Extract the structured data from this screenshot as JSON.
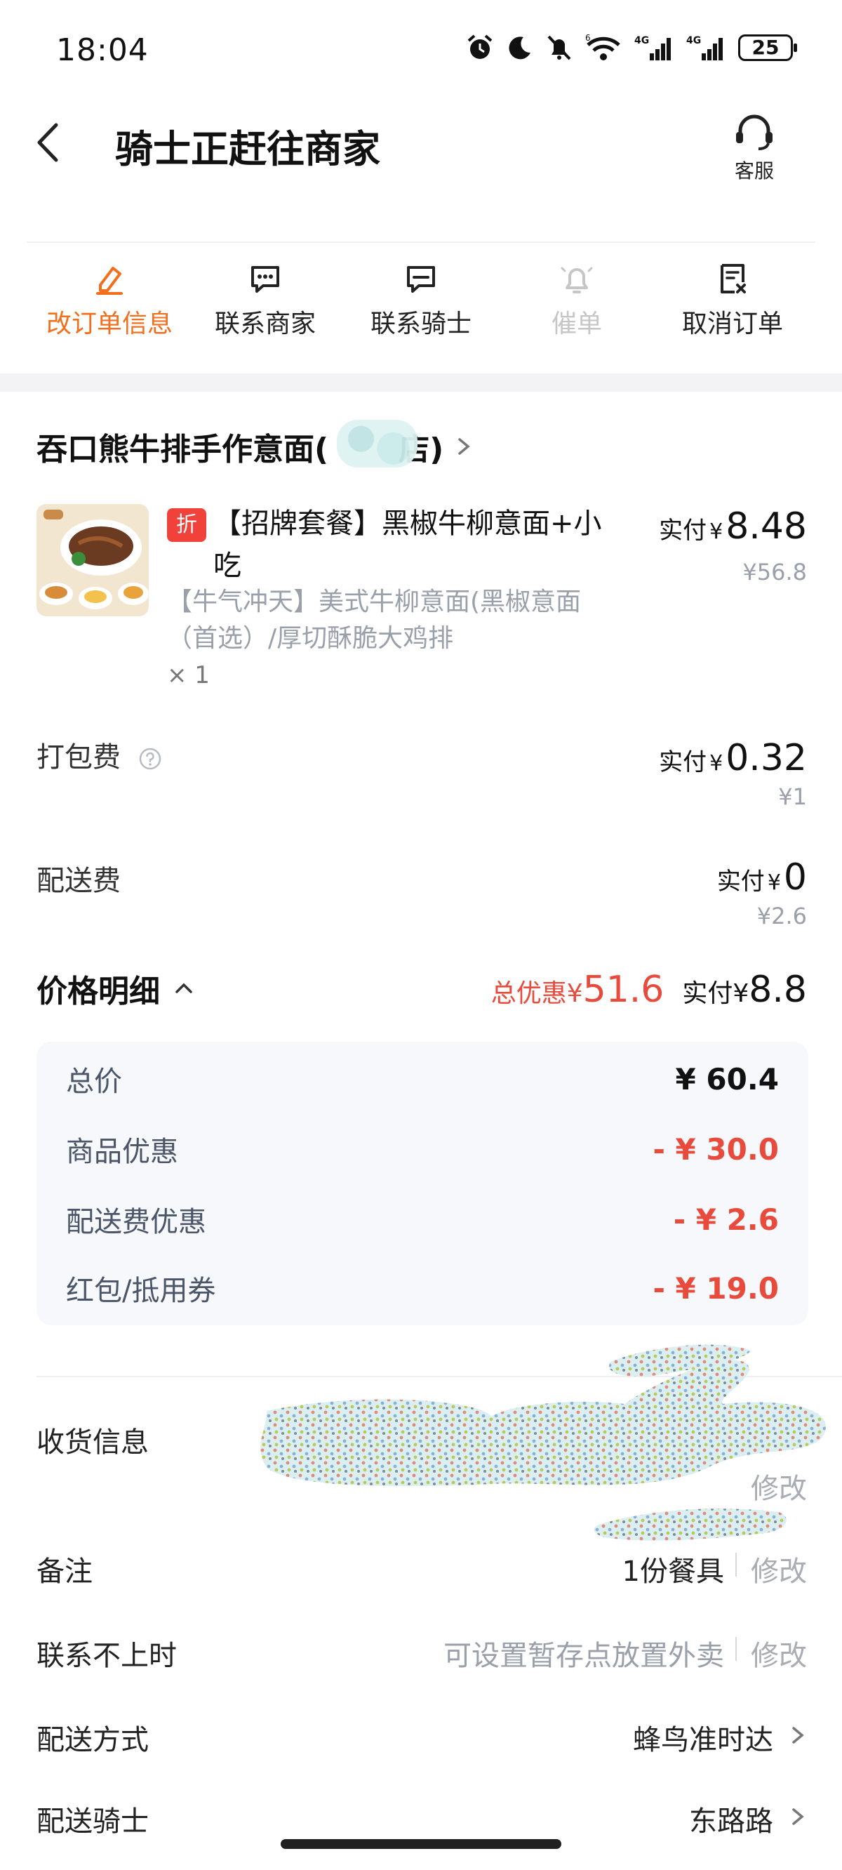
{
  "status_bar": {
    "time": "18:04",
    "battery": "25"
  },
  "header": {
    "title": "骑士正赶往商家",
    "service_label": "客服"
  },
  "actions": [
    {
      "label": "改订单信息",
      "state": "active",
      "icon": "edit-icon"
    },
    {
      "label": "联系商家",
      "state": "normal",
      "icon": "chat-icon"
    },
    {
      "label": "联系骑士",
      "state": "normal",
      "icon": "chat-icon"
    },
    {
      "label": "催单",
      "state": "disabled",
      "icon": "bell-icon"
    },
    {
      "label": "取消订单",
      "state": "normal",
      "icon": "cancel-doc-icon"
    }
  ],
  "store": {
    "name_prefix": "吞口熊牛排手作意面(",
    "name_suffix": "店)"
  },
  "product": {
    "tag": "折",
    "name": "【招牌套餐】黑椒牛柳意面+小吃",
    "spec": "【牛气冲天】美式牛柳意面(黑椒意面（首选）/厚切酥脆大鸡排",
    "qty": "× 1",
    "paid_label": "实付",
    "currency": "¥",
    "paid_value": "8.48",
    "original_price": "¥56.8"
  },
  "fees": {
    "packing": {
      "label": "打包费",
      "paid_label": "实付",
      "currency": "¥",
      "paid_value": "0.32",
      "original": "¥1"
    },
    "delivery": {
      "label": "配送费",
      "paid_label": "实付",
      "currency": "¥",
      "paid_value": "0",
      "original": "¥2.6"
    }
  },
  "price_detail": {
    "title": "价格明细",
    "discount_label": "总优惠¥",
    "discount_value": "51.6",
    "paid_label": "实付¥",
    "paid_value": "8.8",
    "rows": [
      {
        "label": "总价",
        "value": "¥ 60.4"
      },
      {
        "label": "商品优惠",
        "value": "- ¥ 30.0"
      },
      {
        "label": "配送费优惠",
        "value": "- ¥ 2.6"
      },
      {
        "label": "红包/抵用券",
        "value": "- ¥ 19.0"
      }
    ]
  },
  "info": {
    "address": {
      "label": "收货信息",
      "edit": "修改"
    },
    "note": {
      "label": "备注",
      "value": "1份餐具",
      "edit": "修改"
    },
    "unreachable": {
      "label": "联系不上时",
      "value": "可设置暂存点放置外卖",
      "edit": "修改"
    },
    "delivery_method": {
      "label": "配送方式",
      "value": "蜂鸟准时达"
    },
    "rider": {
      "label": "配送骑士",
      "value": "东路路"
    }
  },
  "colors": {
    "accent": "#f26f1d",
    "discount_red": "#e84b3c",
    "tag_red": "#f0413a"
  }
}
